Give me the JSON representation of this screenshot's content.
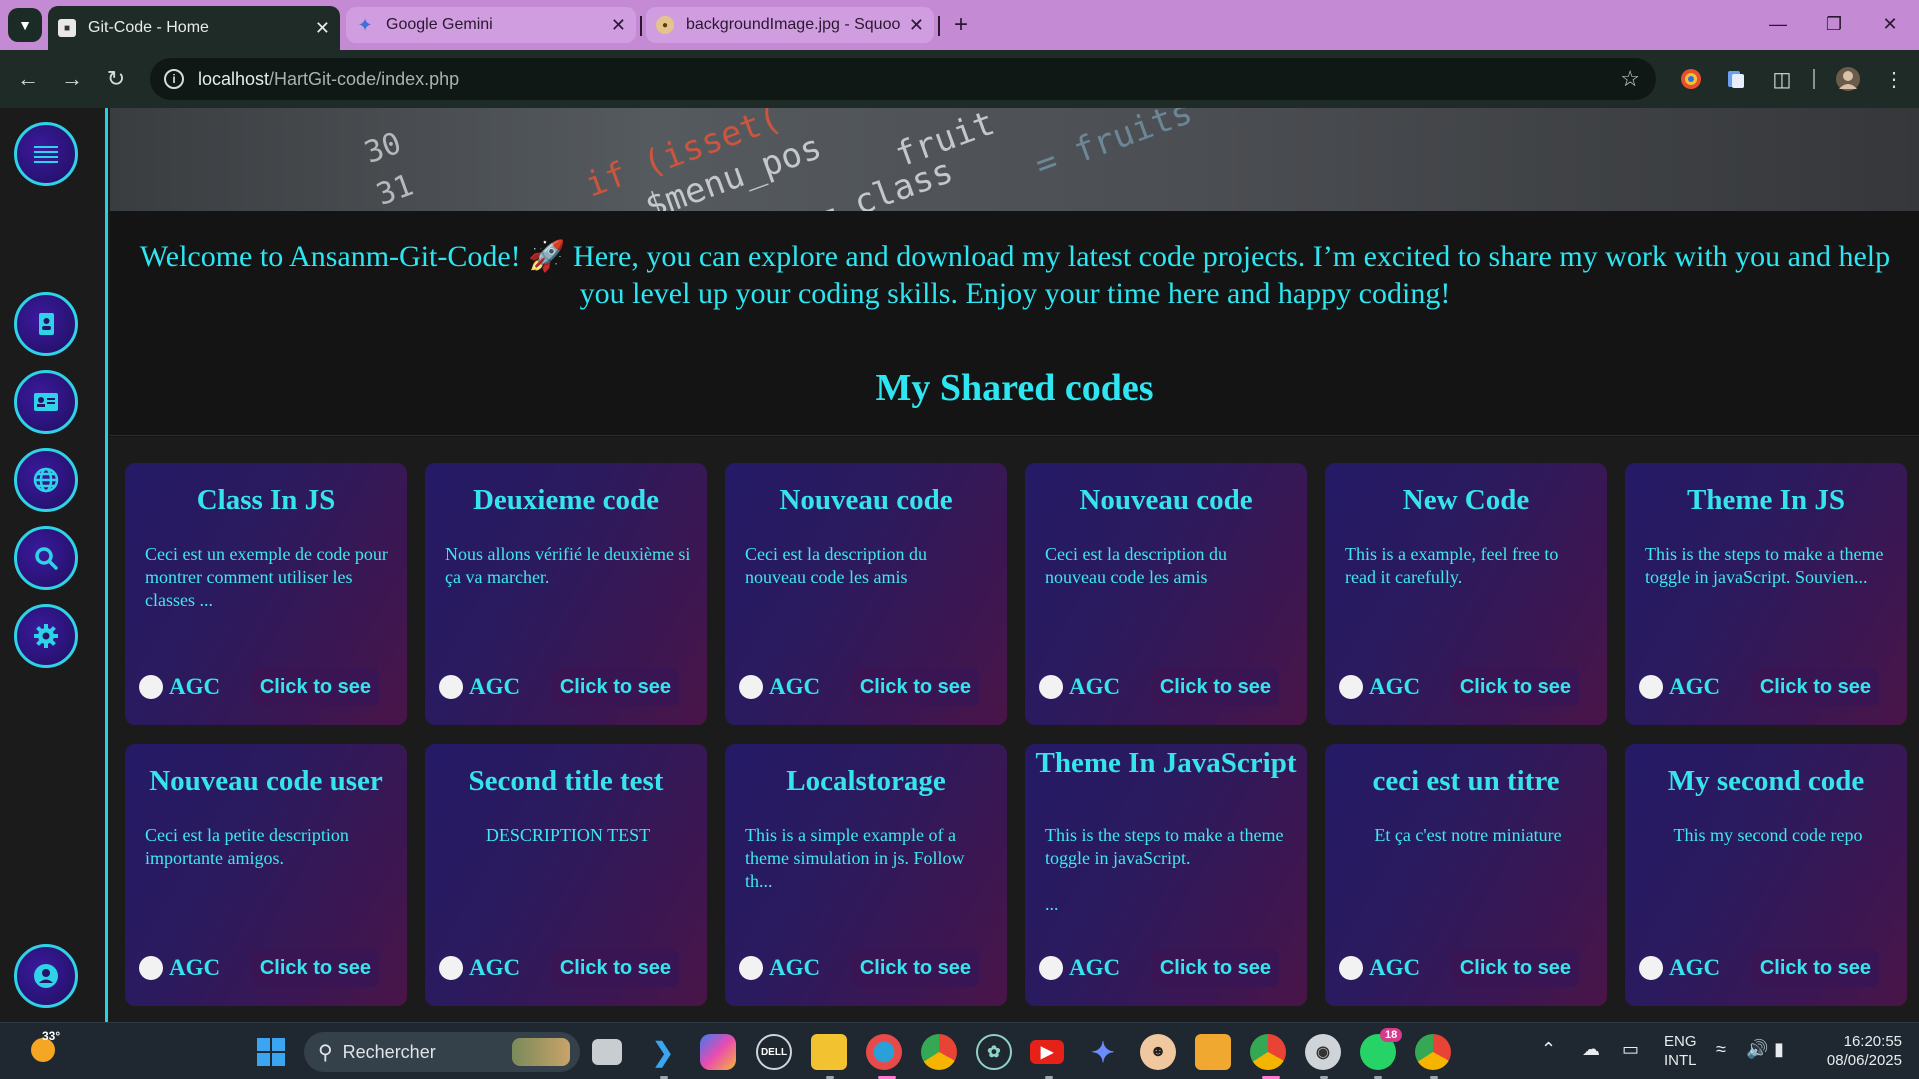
{
  "browser": {
    "tabs": [
      {
        "title": "Git-Code - Home",
        "active": true
      },
      {
        "title": "Google Gemini",
        "active": false
      },
      {
        "title": "backgroundImage.jpg - Squoosh",
        "active": false
      }
    ],
    "url_host": "localhost",
    "url_path": "/HartGit-code/index.php"
  },
  "page": {
    "welcome": "Welcome to Ansanm-Git-Code! 🚀 Here, you can explore and download my latest code projects. I’m excited to share my work with you and help you level up your coding skills. Enjoy your time here and happy coding!",
    "section_title": "My Shared codes",
    "banner_code": [
      "30",
      "31",
      "if (isset(",
      "$menu_pos",
      "= class",
      "fruit",
      "= fruits"
    ],
    "cards": [
      {
        "title": "Class In JS",
        "desc": "Ceci est un exemple de code pour montrer comment utiliser les classes ...",
        "author": "AGC",
        "button": "Click to see"
      },
      {
        "title": "Deuxieme code",
        "desc": "Nous allons vérifié le deuxième si ça va marcher.",
        "author": "AGC",
        "button": "Click to see"
      },
      {
        "title": "Nouveau code",
        "desc": "Ceci est la description du nouveau code les amis",
        "author": "AGC",
        "button": "Click to see"
      },
      {
        "title": "Nouveau code",
        "desc": "Ceci est la description du nouveau code les amis",
        "author": "AGC",
        "button": "Click to see"
      },
      {
        "title": "New Code",
        "desc": "This is a example, feel free to read it carefully.",
        "author": "AGC",
        "button": "Click to see"
      },
      {
        "title": "Theme In JS",
        "desc": "This is the steps to make a theme toggle in javaScript. Souvien...",
        "author": "AGC",
        "button": "Click to see"
      },
      {
        "title": "Nouveau code user",
        "desc": "Ceci est la petite description importante amigos.",
        "author": "AGC",
        "button": "Click to see"
      },
      {
        "title": "Second title test",
        "desc": "DESCRIPTION TEST",
        "author": "AGC",
        "button": "Click to see"
      },
      {
        "title": "Localstorage",
        "desc": "This is a simple example of a theme simulation in js. Follow th...",
        "author": "AGC",
        "button": "Click to see"
      },
      {
        "title": "Theme In JavaScript",
        "desc": "This is the steps to make a theme toggle in javaScript.\n\n...",
        "author": "AGC",
        "button": "Click to see"
      },
      {
        "title": "ceci est un titre",
        "desc": "Et ça c'est notre miniature",
        "author": "AGC",
        "button": "Click to see"
      },
      {
        "title": "My second code",
        "desc": "This my second code repo",
        "author": "AGC",
        "button": "Click to see"
      }
    ],
    "sidebar_icons": [
      "menu-icon",
      "contact-book-icon",
      "id-card-icon",
      "globe-icon",
      "search-icon",
      "gear-icon",
      "user-icon"
    ]
  },
  "taskbar": {
    "weather_temp": "33°",
    "search_placeholder": "Rechercher",
    "lang_line1": "ENG",
    "lang_line2": "INTL",
    "time": "16:20:55",
    "date": "08/06/2025",
    "whatsapp_badge": "18"
  },
  "colors": {
    "accent": "#2ee6f2",
    "tabbar": "#c48ad4",
    "card_start": "#241a66",
    "card_end": "#4a1548"
  }
}
